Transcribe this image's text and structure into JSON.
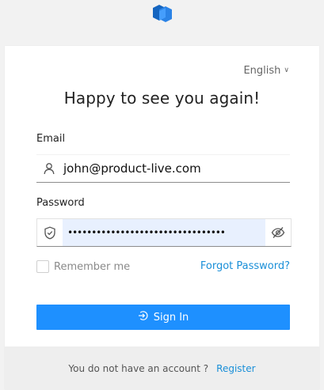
{
  "brand": {
    "logo_icon": "hexagon-logo-icon",
    "primary_color": "#1e90ff",
    "logo_colors": [
      "#1565c0",
      "#2b83e6",
      "#4aa3ff"
    ]
  },
  "language": {
    "selected": "English",
    "chevron_icon": "chevron-down-icon"
  },
  "title": "Happy to see you again!",
  "email": {
    "label": "Email",
    "value": "john@product-live.com",
    "icon": "user-icon"
  },
  "password": {
    "label": "Password",
    "masked_value": "•••••••••••••••••••••••••••••••••",
    "prefix_icon": "shield-icon",
    "toggle_icon": "eye-slash-icon"
  },
  "remember_me": {
    "label": "Remember me",
    "checked": false
  },
  "forgot_password": "Forgot Password?",
  "sign_in": {
    "label": "Sign In",
    "icon": "login-icon"
  },
  "footer": {
    "prompt": "You do not have an account ?",
    "register_label": "Register"
  }
}
